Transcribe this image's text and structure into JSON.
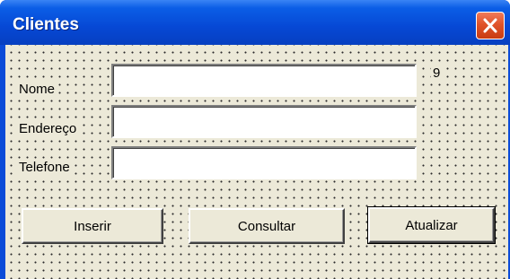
{
  "window": {
    "title": "Clientes",
    "close_icon": "close-icon"
  },
  "form": {
    "fields": [
      {
        "label": "Nome",
        "value": ""
      },
      {
        "label": "Endereço",
        "value": ""
      },
      {
        "label": "Telefone",
        "value": ""
      }
    ],
    "counter": "9"
  },
  "buttons": {
    "insert": "Inserir",
    "query": "Consultar",
    "update": "Atualizar"
  },
  "colors": {
    "titlebar": "#0648d5",
    "form_background": "#ece9d8",
    "close_button": "#e0532a"
  }
}
